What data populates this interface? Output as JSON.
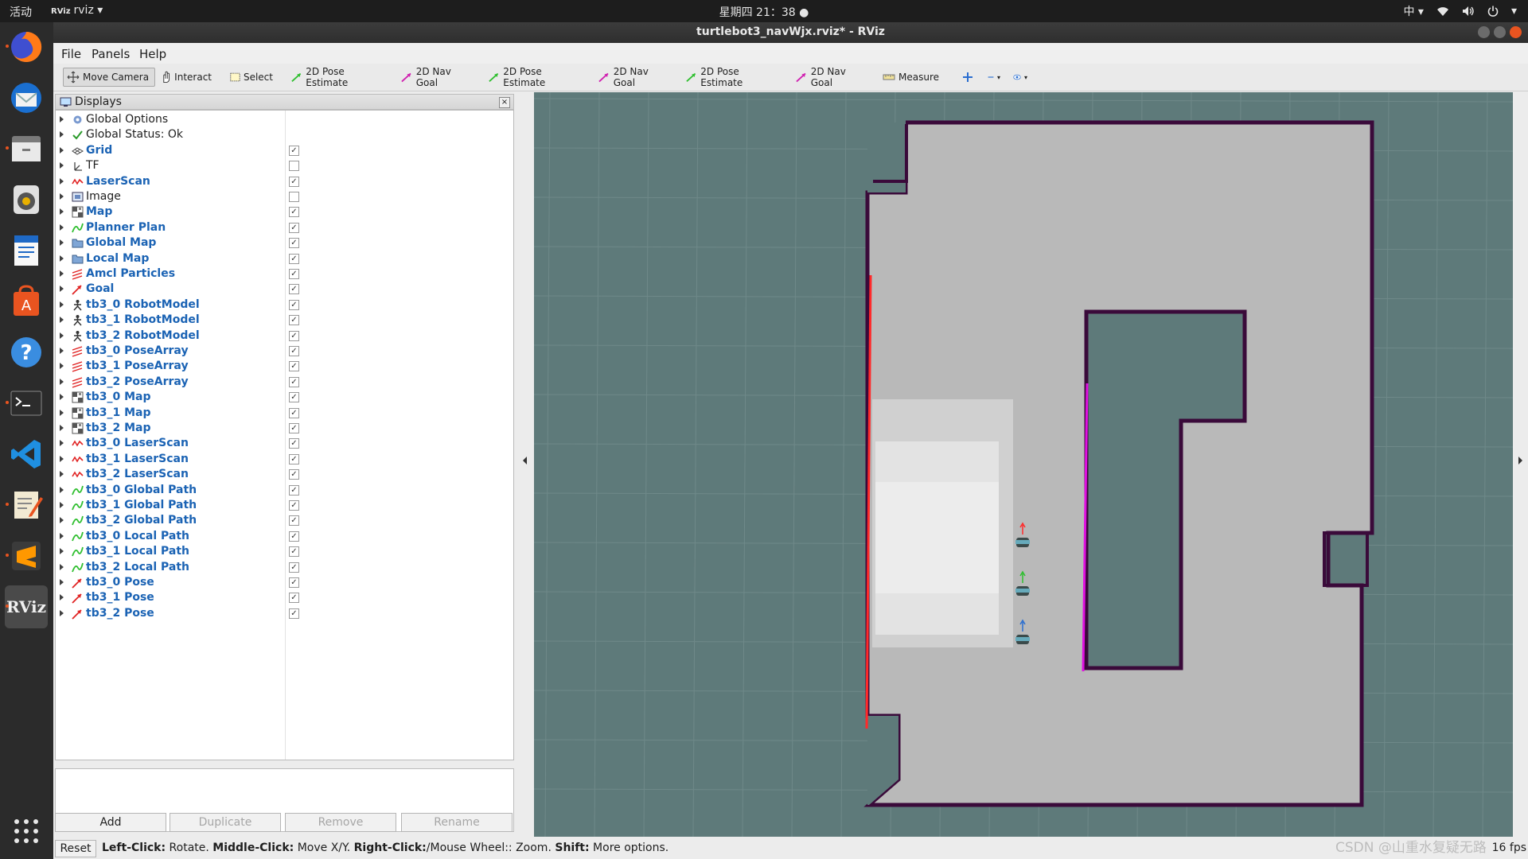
{
  "topbar": {
    "activities": "活动",
    "app_name": "rviz",
    "app_badge": "RViz",
    "clock": "星期四 21：38",
    "input_method": "中"
  },
  "dock": {
    "items": [
      "firefox-icon",
      "thunderbird-icon",
      "files-icon",
      "rhythmbox-icon",
      "writer-icon",
      "software-icon",
      "help-icon",
      "terminal-icon",
      "vscode-icon",
      "text-editor-icon",
      "sublime-icon",
      "rviz-icon"
    ],
    "rviz_label": "RViz"
  },
  "window": {
    "title": "turtlebot3_navWjx.rviz* - RViz"
  },
  "menubar": {
    "file": "File",
    "panels": "Panels",
    "help": "Help"
  },
  "toolbar": {
    "move_camera": "Move Camera",
    "interact": "Interact",
    "select": "Select",
    "pose1": "2D Pose Estimate",
    "nav1": "2D Nav Goal",
    "pose2": "2D Pose Estimate",
    "nav2": "2D Nav Goal",
    "pose3": "2D Pose Estimate",
    "nav3": "2D Nav Goal",
    "measure": "Measure"
  },
  "displays": {
    "title": "Displays",
    "close": "×",
    "rows": [
      {
        "name": "Global Options",
        "icon": "gear-icon",
        "checkbox": null,
        "blue": false
      },
      {
        "name": "Global Status: Ok",
        "icon": "checkmark-icon",
        "checkbox": null,
        "blue": false
      },
      {
        "name": "Grid",
        "icon": "grid-icon",
        "checkbox": true,
        "blue": true
      },
      {
        "name": "TF",
        "icon": "tf-axes-icon",
        "checkbox": false,
        "blue": false
      },
      {
        "name": "LaserScan",
        "icon": "laserscan-icon",
        "checkbox": true,
        "blue": true
      },
      {
        "name": "Image",
        "icon": "image-icon",
        "checkbox": false,
        "blue": false
      },
      {
        "name": "Map",
        "icon": "map-icon",
        "checkbox": true,
        "blue": true
      },
      {
        "name": "Planner Plan",
        "icon": "path-icon",
        "checkbox": true,
        "blue": true
      },
      {
        "name": "Global Map",
        "icon": "folder-icon",
        "checkbox": true,
        "blue": true
      },
      {
        "name": "Local Map",
        "icon": "folder-icon",
        "checkbox": true,
        "blue": true
      },
      {
        "name": "Amcl Particles",
        "icon": "posearray-icon",
        "checkbox": true,
        "blue": true
      },
      {
        "name": "Goal",
        "icon": "pose-icon",
        "checkbox": true,
        "blue": true
      },
      {
        "name": "tb3_0 RobotModel",
        "icon": "robot-icon",
        "checkbox": true,
        "blue": true
      },
      {
        "name": "tb3_1 RobotModel",
        "icon": "robot-icon",
        "checkbox": true,
        "blue": true
      },
      {
        "name": "tb3_2 RobotModel",
        "icon": "robot-icon",
        "checkbox": true,
        "blue": true
      },
      {
        "name": "tb3_0 PoseArray",
        "icon": "posearray-icon",
        "checkbox": true,
        "blue": true
      },
      {
        "name": "tb3_1 PoseArray",
        "icon": "posearray-icon",
        "checkbox": true,
        "blue": true
      },
      {
        "name": "tb3_2 PoseArray",
        "icon": "posearray-icon",
        "checkbox": true,
        "blue": true
      },
      {
        "name": "tb3_0 Map",
        "icon": "map-icon",
        "checkbox": true,
        "blue": true
      },
      {
        "name": "tb3_1 Map",
        "icon": "map-icon",
        "checkbox": true,
        "blue": true
      },
      {
        "name": "tb3_2 Map",
        "icon": "map-icon",
        "checkbox": true,
        "blue": true
      },
      {
        "name": "tb3_0 LaserScan",
        "icon": "laserscan-icon",
        "checkbox": true,
        "blue": true
      },
      {
        "name": "tb3_1 LaserScan",
        "icon": "laserscan-icon",
        "checkbox": true,
        "blue": true
      },
      {
        "name": "tb3_2 LaserScan",
        "icon": "laserscan-icon",
        "checkbox": true,
        "blue": true
      },
      {
        "name": "tb3_0 Global Path",
        "icon": "path-icon",
        "checkbox": true,
        "blue": true
      },
      {
        "name": "tb3_1 Global Path",
        "icon": "path-icon",
        "checkbox": true,
        "blue": true
      },
      {
        "name": "tb3_2 Global Path",
        "icon": "path-icon",
        "checkbox": true,
        "blue": true
      },
      {
        "name": "tb3_0 Local Path",
        "icon": "path-icon",
        "checkbox": true,
        "blue": true
      },
      {
        "name": "tb3_1 Local Path",
        "icon": "path-icon",
        "checkbox": true,
        "blue": true
      },
      {
        "name": "tb3_2 Local Path",
        "icon": "path-icon",
        "checkbox": true,
        "blue": true
      },
      {
        "name": "tb3_0 Pose",
        "icon": "pose-icon",
        "checkbox": true,
        "blue": true
      },
      {
        "name": "tb3_1 Pose",
        "icon": "pose-icon",
        "checkbox": true,
        "blue": true
      },
      {
        "name": "tb3_2 Pose",
        "icon": "pose-icon",
        "checkbox": true,
        "blue": true
      }
    ]
  },
  "panel_buttons": {
    "add": "Add",
    "duplicate": "Duplicate",
    "remove": "Remove",
    "rename": "Rename"
  },
  "status": {
    "reset": "Reset",
    "hint_parts": [
      {
        "b": "Left-Click:",
        "t": " Rotate. "
      },
      {
        "b": "Middle-Click:",
        "t": " Move X/Y. "
      },
      {
        "b": "Right-Click:",
        "t": "/Mouse Wheel:: Zoom. "
      },
      {
        "b": "Shift:",
        "t": " More options."
      }
    ],
    "fps": "16 fps"
  },
  "watermark": "CSDN @山重水复疑无路",
  "colors": {
    "grid_bg": "#5e7a7a",
    "free_space": "#b9b9b9",
    "obstacle": "#3a0a3a",
    "laser_red": "#ff2a2a",
    "laser_magenta": "#e010e0",
    "accent": "#e95420"
  }
}
